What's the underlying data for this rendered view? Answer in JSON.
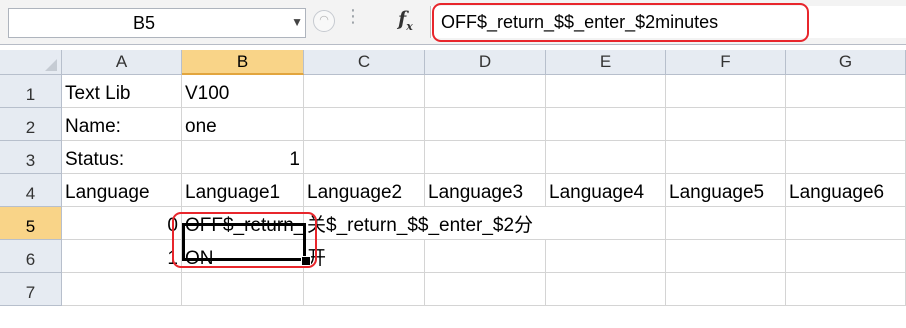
{
  "formula_bar": {
    "name_box": "B5",
    "formula": "OFF$_return_$$_enter_$2minutes",
    "fx_label": "f",
    "fx_sub": "x"
  },
  "columns": [
    "A",
    "B",
    "C",
    "D",
    "E",
    "F",
    "G"
  ],
  "rows": [
    "1",
    "2",
    "3",
    "4",
    "5",
    "6",
    "7"
  ],
  "cells": {
    "A1": "Text Lib",
    "B1": "V100",
    "A2": "Name:",
    "B2": "one",
    "A3": "Status:",
    "B3": "1",
    "A4": "Language",
    "B4": "Language1",
    "C4": "Language2",
    "D4": "Language3",
    "E4": "Language4",
    "F4": "Language5",
    "G4": "Language6",
    "A5": "0",
    "B5": "OFF$_return_$$_enter_$2minutes",
    "C5": "关$_return_$$_enter_$2分",
    "A6": "1",
    "B6": "ON",
    "C6": "开"
  },
  "selection": {
    "active_cell": "B5",
    "selected_column": "B",
    "selected_row": "5"
  },
  "colors": {
    "highlight": "#e8262c",
    "header_selected": "#f9d488"
  }
}
